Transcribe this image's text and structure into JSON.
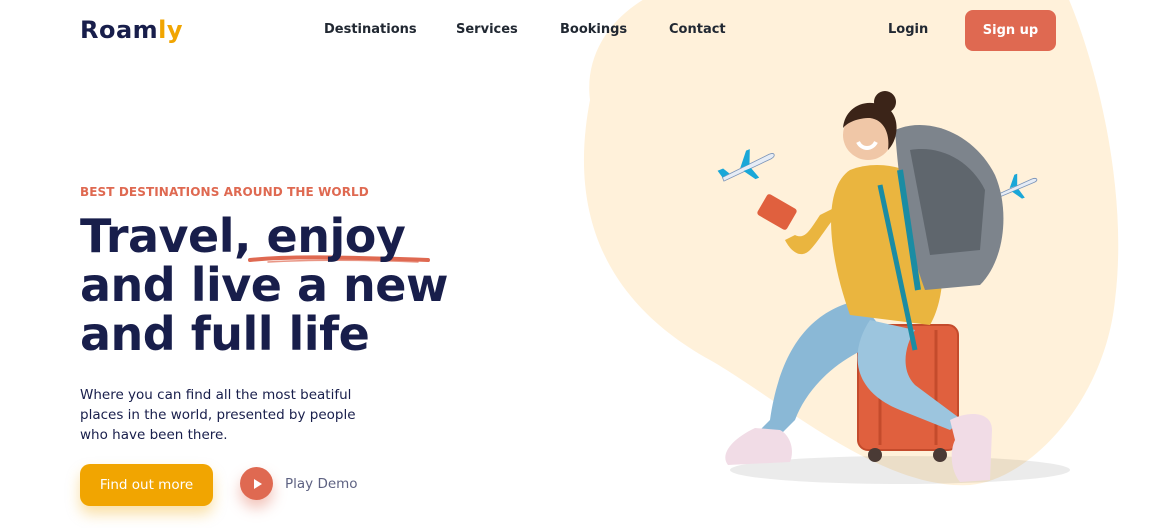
{
  "header": {
    "logo_main": "Roam",
    "logo_accent": "ly",
    "nav": [
      "Destinations",
      "Services",
      "Bookings",
      "Contact"
    ],
    "login_label": "Login",
    "signup_label": "Sign up"
  },
  "hero": {
    "eyebrow": "BEST DESTINATIONS AROUND THE WORLD",
    "headline_line1_pre": "Travel, ",
    "headline_line1_highlight": "enjoy",
    "headline_line2": "and live a new",
    "headline_line3": "and full life",
    "description": "Where you can find all the most beatiful places in the world, presented by people who have been there.",
    "cta_label": "Find out more",
    "play_label": "Play Demo"
  },
  "colors": {
    "primary": "#181e4b",
    "accent_orange": "#df6951",
    "accent_yellow": "#f1a501",
    "blob": "#fff1da",
    "plane": "#84829a"
  },
  "icons": {
    "play": "play-icon",
    "plane": "airplane-icon"
  }
}
